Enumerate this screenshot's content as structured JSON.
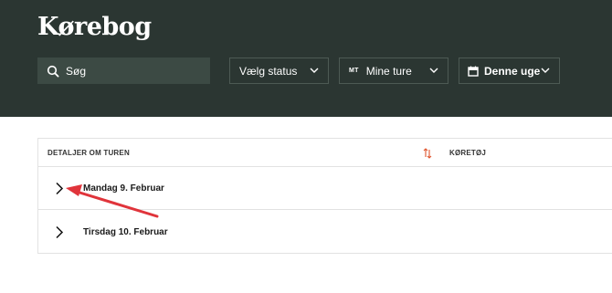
{
  "header": {
    "title": "Kørebog"
  },
  "search": {
    "placeholder": "Søg"
  },
  "filters": {
    "status_label": "Vælg status",
    "tours_badge": "MT",
    "tours_label": "Mine ture",
    "week_label": "Denne uge"
  },
  "table": {
    "col_details": "DETALJER OM TUREN",
    "col_vehicle": "KØRETØJ",
    "rows": [
      {
        "label": "Mandag 9. Februar"
      },
      {
        "label": "Tirsdag 10. Februar"
      }
    ]
  },
  "colors": {
    "header_bg": "#2b3632",
    "search_bg": "#3c4a44",
    "sort_accent": "#e0552e",
    "annotation_arrow": "#e0343b"
  }
}
